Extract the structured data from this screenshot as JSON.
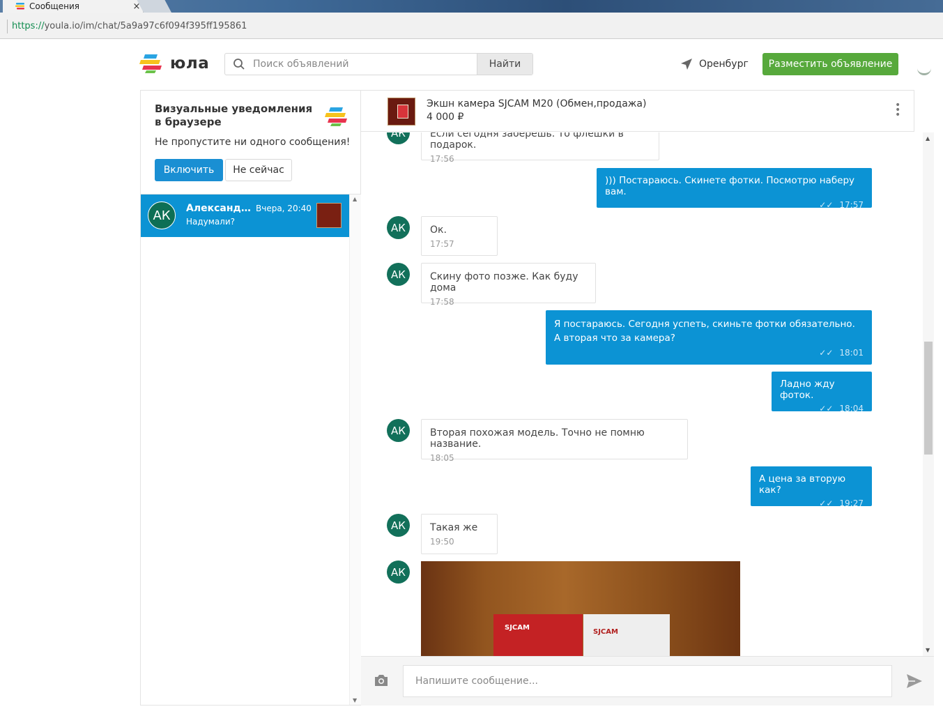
{
  "browser": {
    "tab_title": "Сообщения",
    "tab_close": "×",
    "url_proto": "https://",
    "url_rest": "youla.io/im/chat/5a9a97c6f094f395ff195861"
  },
  "header": {
    "logo_text": "юла",
    "search_placeholder": "Поиск объявлений",
    "search_button": "Найти",
    "city": "Оренбург",
    "post_button": "Разместить объявление"
  },
  "notification": {
    "title": "Визуальные уведомления в браузере",
    "text": "Не пропустите ни одного сообщения!",
    "enable": "Включить",
    "not_now": "Не сейчас"
  },
  "conversations": [
    {
      "initials": "АК",
      "name": "Александр...",
      "time": "Вчера, 20:40",
      "preview": "Надумали?"
    }
  ],
  "chat": {
    "product_title": "Экшн камера SJCAM M20 (Обмен,продажа)",
    "product_price": "4 000 ₽",
    "messages": [
      {
        "dir": "in",
        "initials": "АК",
        "text": "Если сегодня заберешь. То флешки в подарок.",
        "time": "17:56"
      },
      {
        "dir": "out",
        "text": "))) Постараюсь. Скинете фотки. Посмотрю наберу вам.",
        "time": "17:57"
      },
      {
        "dir": "in",
        "initials": "АК",
        "text": "Ок.",
        "time": "17:57"
      },
      {
        "dir": "in",
        "initials": "АК",
        "text": "Скину фото позже. Как буду дома",
        "time": "17:58"
      },
      {
        "dir": "out",
        "text": "Я постараюсь. Сегодня успеть, скиньте фотки обязательно. А вторая что за камера?",
        "time": "18:01"
      },
      {
        "dir": "out",
        "text": "Ладно жду фоток.",
        "time": "18:04"
      },
      {
        "dir": "in",
        "initials": "АК",
        "text": "Вторая похожая модель. Точно не помню название.",
        "time": "18:05"
      },
      {
        "dir": "out",
        "text": "А цена за вторую как?",
        "time": "19:27"
      },
      {
        "dir": "in",
        "initials": "АК",
        "text": "Такая же",
        "time": "19:50"
      },
      {
        "dir": "in",
        "initials": "АК",
        "type": "photo",
        "brand_1": "SJCAM",
        "brand_2": "SJCAM"
      }
    ],
    "composer_placeholder": "Напишите сообщение..."
  },
  "colors": {
    "accent_blue": "#0c93d4",
    "green_button": "#57a93c",
    "avatar_green": "#12705a"
  }
}
